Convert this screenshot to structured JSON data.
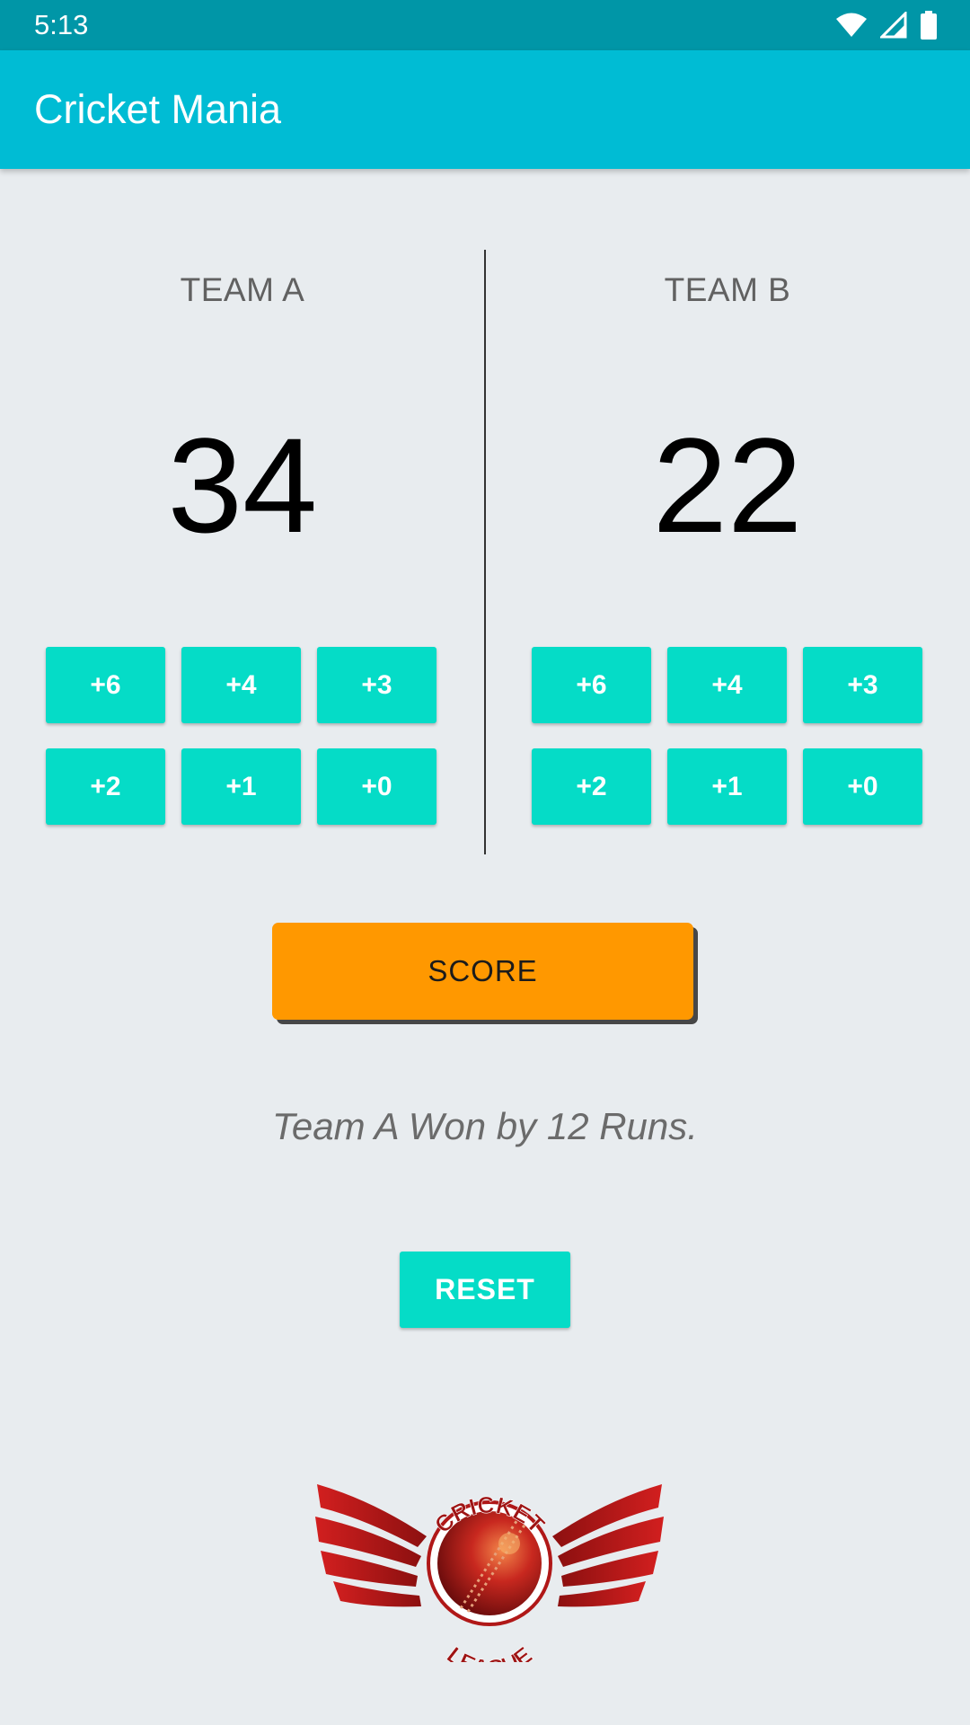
{
  "status_bar": {
    "time": "5:13",
    "icons": [
      "wifi-icon",
      "signal-icon",
      "battery-icon"
    ]
  },
  "app_bar": {
    "title": "Cricket Mania",
    "color": "#00bcd4"
  },
  "teams": [
    {
      "name": "TEAM A",
      "score": "34",
      "buttons": [
        "+6",
        "+4",
        "+3",
        "+2",
        "+1",
        "+0"
      ]
    },
    {
      "name": "TEAM B",
      "score": "22",
      "buttons": [
        "+6",
        "+4",
        "+3",
        "+2",
        "+1",
        "+0"
      ]
    }
  ],
  "score_button": {
    "label": "SCORE",
    "color": "#ff9800"
  },
  "result": "Team A Won by 12 Runs.",
  "reset_button": {
    "label": "RESET",
    "color": "#05dcc7"
  },
  "logo": {
    "text_top": "CRICKET",
    "text_bottom": "LEAGUE"
  }
}
